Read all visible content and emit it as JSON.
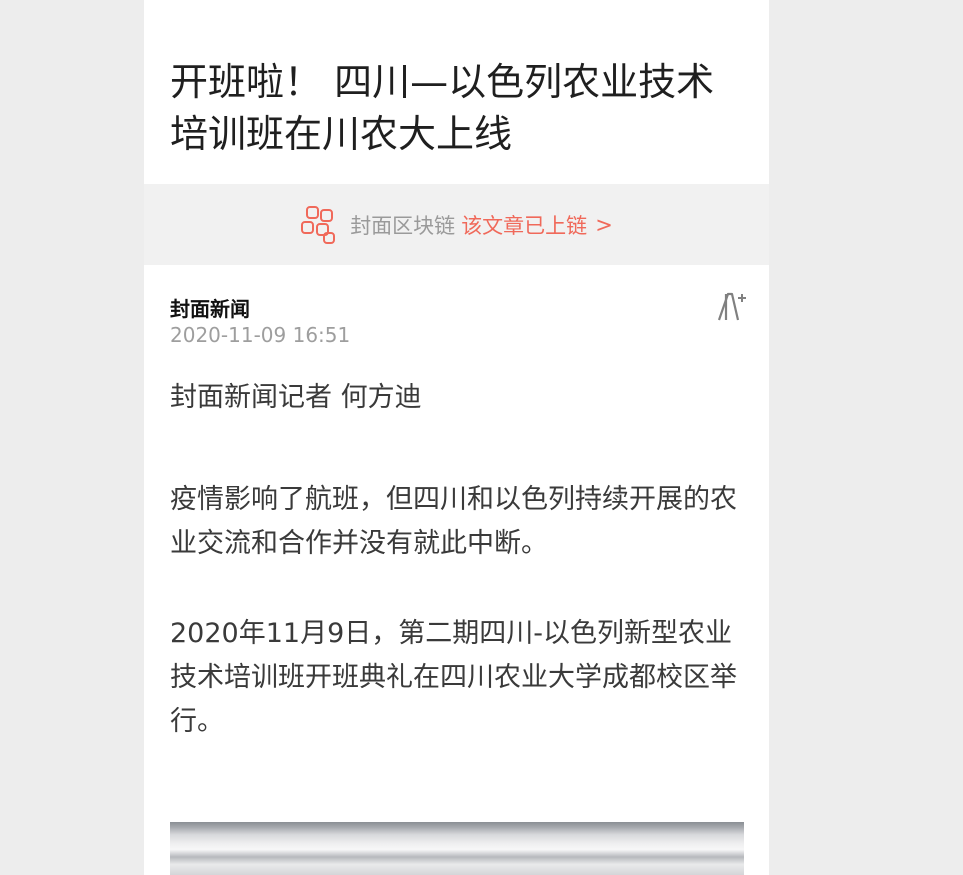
{
  "article": {
    "title": "开班啦！ 四川—以色列农业技术培训班在川农大上线",
    "chain_bar": {
      "icon": "blockchain-icon",
      "label": "封面区块链",
      "link_text": "该文章已上链",
      "arrow": ">"
    },
    "source": "封面新闻",
    "datetime": "2020-11-09 16:51",
    "font_size_icon": "font-size-icon",
    "reporter_line": "封面新闻记者  何方迪",
    "paragraphs": [
      "疫情影响了航班，但四川和以色列持续开展的农业交流和合作并没有就此中断。",
      "2020年11月9日，第二期四川-以色列新型农业技术培训班开班典礼在四川农业大学成都校区举行。"
    ],
    "image": "article-photo"
  },
  "colors": {
    "background": "#ededed",
    "accent": "#f0695a",
    "muted": "#9e9e9e",
    "text": "#3a3a3a"
  }
}
